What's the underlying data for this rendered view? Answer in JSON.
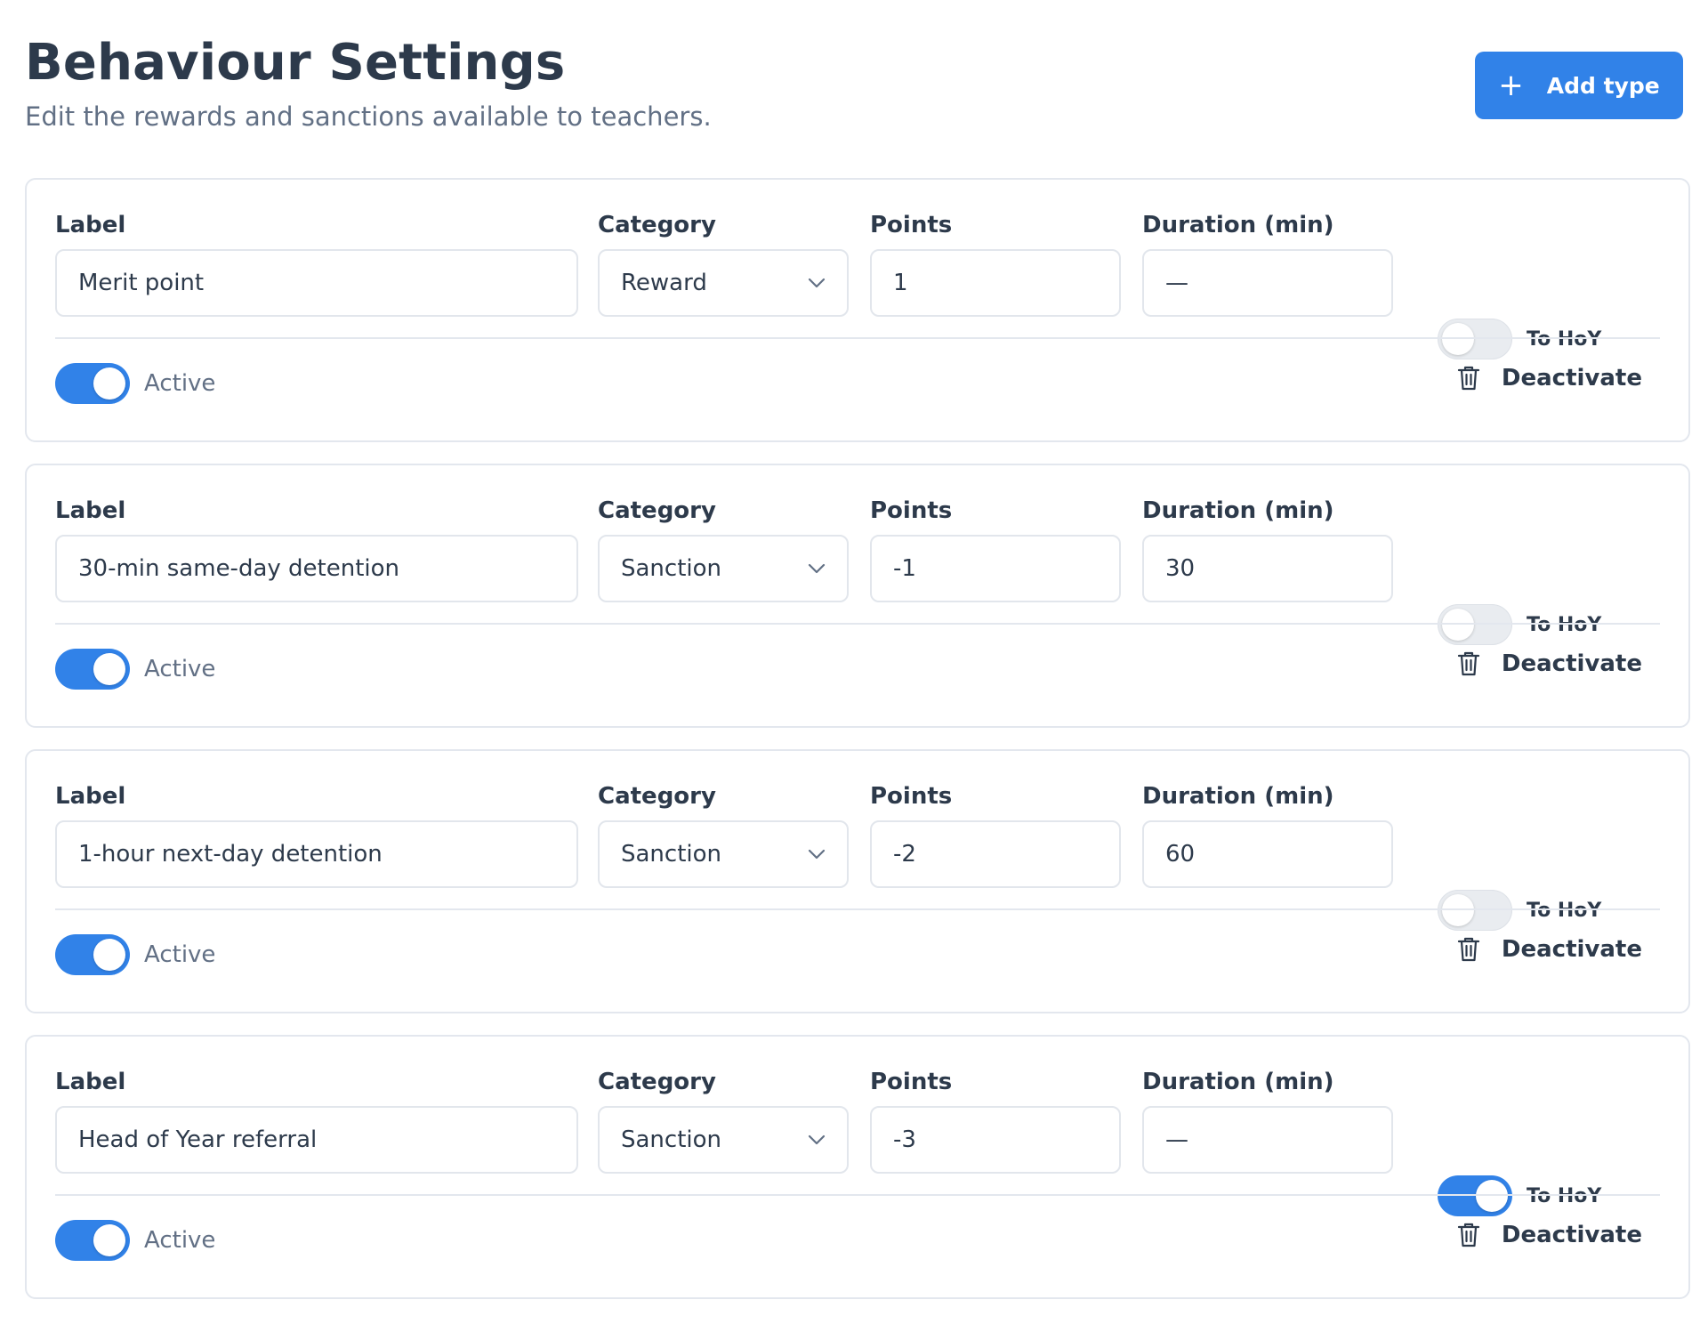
{
  "header": {
    "title": "Behaviour Settings",
    "subtitle": "Edit the rewards and sanctions available to teachers.",
    "add_button_label": "Add type",
    "add_button_icon": "plus-icon",
    "accent_color": "#3182e8"
  },
  "field_labels": {
    "label": "Label",
    "category": "Category",
    "points": "Points",
    "duration": "Duration (min)",
    "to_hoy": "To HoY",
    "active": "Active",
    "deactivate": "Deactivate"
  },
  "types": [
    {
      "label": "Merit point",
      "category": "Reward",
      "points": "1",
      "duration": "—",
      "to_hoy": false,
      "active": true
    },
    {
      "label": "30-min same-day detention",
      "category": "Sanction",
      "points": "-1",
      "duration": "30",
      "to_hoy": false,
      "active": true
    },
    {
      "label": "1-hour next-day detention",
      "category": "Sanction",
      "points": "-2",
      "duration": "60",
      "to_hoy": false,
      "active": true
    },
    {
      "label": "Head of Year referral",
      "category": "Sanction",
      "points": "-3",
      "duration": "—",
      "to_hoy": true,
      "active": true
    }
  ]
}
